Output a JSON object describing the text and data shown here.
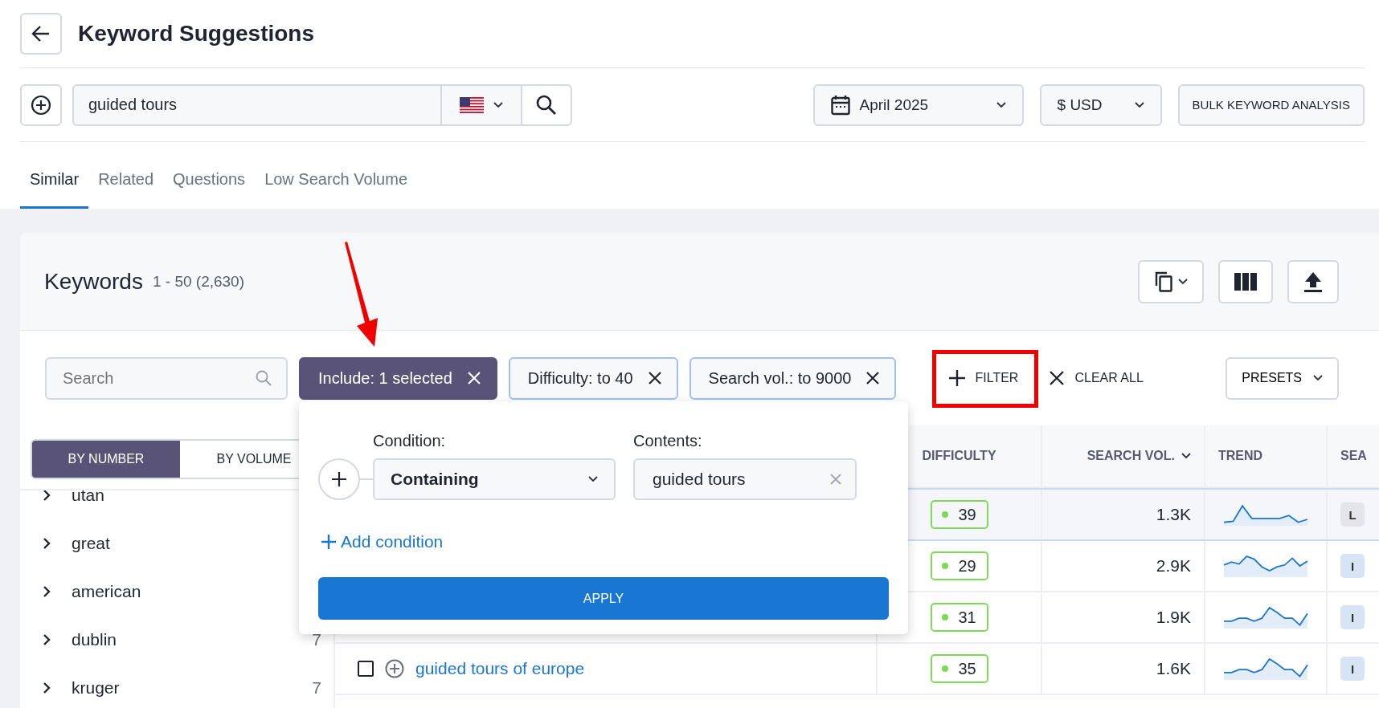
{
  "header": {
    "title": "Keyword Suggestions"
  },
  "search": {
    "value": "guided tours"
  },
  "date": {
    "value": "April 2025"
  },
  "currency": {
    "value": "$ USD"
  },
  "bulk_button": "BULK KEYWORD ANALYSIS",
  "tabs": [
    {
      "label": "Similar",
      "selected": true
    },
    {
      "label": "Related",
      "selected": false
    },
    {
      "label": "Questions",
      "selected": false
    },
    {
      "label": "Low Search Volume",
      "selected": false
    }
  ],
  "keywords_panel": {
    "title": "Keywords",
    "range": "1 - 50 (2,630)"
  },
  "filter_search": {
    "placeholder": "Search"
  },
  "filters": [
    {
      "label": "Include: 1 selected",
      "selected": true
    },
    {
      "label": "Difficulty: to 40",
      "selected": false
    },
    {
      "label": "Search vol.: to 9000",
      "selected": false
    }
  ],
  "filter_button": "FILTER",
  "clear_all": "CLEAR ALL",
  "presets": "PRESETS",
  "group_toggle": [
    {
      "label": "BY NUMBER",
      "selected": true
    },
    {
      "label": "BY VOLUME",
      "selected": false
    }
  ],
  "groups": [
    {
      "label": "utan"
    },
    {
      "label": "great"
    },
    {
      "label": "american"
    },
    {
      "label": "dublin",
      "count": "7"
    },
    {
      "label": "kruger",
      "count": "7"
    }
  ],
  "table": {
    "columns": [
      "DIFFICULTY",
      "SEARCH VOL.",
      "TREND",
      "SEA"
    ],
    "rows": [
      {
        "selected": true,
        "difficulty": "39",
        "search_vol": "1.3K",
        "intent": {
          "label": "L",
          "color": "#e4e4ea"
        }
      },
      {
        "selected": false,
        "difficulty": "29",
        "search_vol": "2.9K",
        "intent": {
          "label": "I",
          "color": "#d6e4f6"
        }
      },
      {
        "selected": false,
        "difficulty": "31",
        "search_vol": "1.9K",
        "intent": {
          "label": "I",
          "color": "#d6e4f6"
        }
      },
      {
        "selected": false,
        "checked": false,
        "keyword": "guided tours of europe",
        "difficulty": "35",
        "search_vol": "1.6K",
        "intent": {
          "label": "I",
          "color": "#d6e4f6"
        }
      }
    ]
  },
  "popup": {
    "condition_label": "Condition:",
    "condition": "Containing",
    "contents_label": "Contents:",
    "contents": "guided tours",
    "add_condition": "Add condition",
    "apply": "APPLY"
  }
}
